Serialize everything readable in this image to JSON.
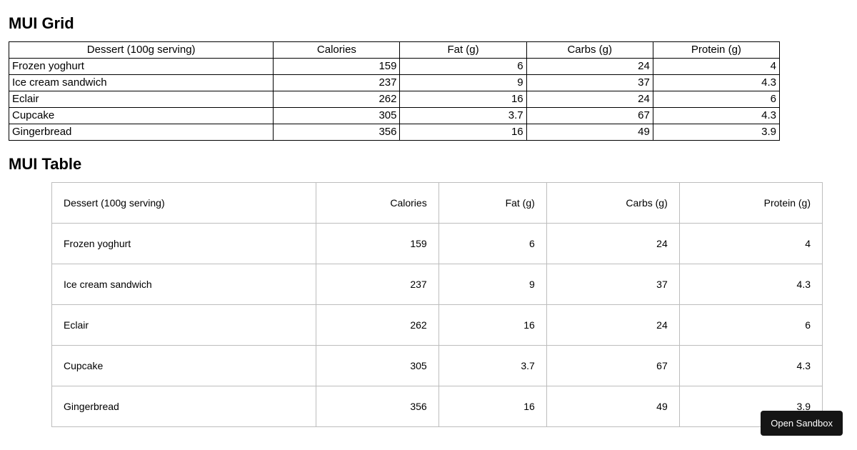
{
  "headings": {
    "grid": "MUI Grid",
    "table": "MUI Table"
  },
  "columns": {
    "dessert": "Dessert (100g serving)",
    "calories": "Calories",
    "fat": "Fat (g)",
    "carbs": "Carbs (g)",
    "protein": "Protein (g)"
  },
  "rows": [
    {
      "name": "Frozen yoghurt",
      "calories": 159,
      "fat": 6,
      "carbs": 24,
      "protein": 4
    },
    {
      "name": "Ice cream sandwich",
      "calories": 237,
      "fat": 9,
      "carbs": 37,
      "protein": 4.3
    },
    {
      "name": "Eclair",
      "calories": 262,
      "fat": 16,
      "carbs": 24,
      "protein": 6
    },
    {
      "name": "Cupcake",
      "calories": 305,
      "fat": 3.7,
      "carbs": 67,
      "protein": 4.3
    },
    {
      "name": "Gingerbread",
      "calories": 356,
      "fat": 16,
      "carbs": 49,
      "protein": 3.9
    }
  ],
  "button": {
    "open_sandbox": "Open Sandbox"
  }
}
